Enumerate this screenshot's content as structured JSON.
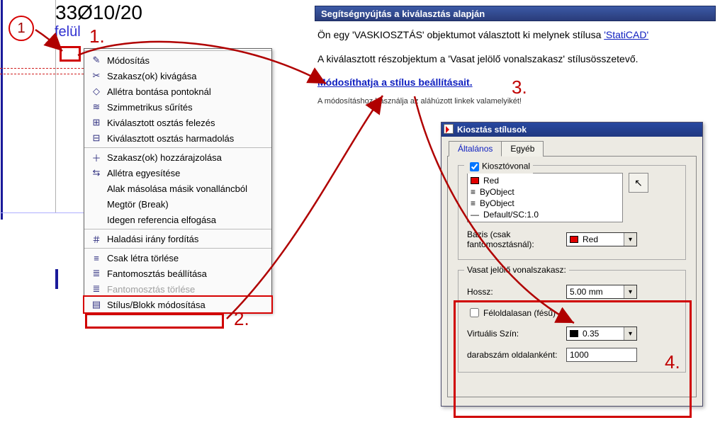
{
  "steps": {
    "s1": "1",
    "s2": "2.",
    "s3": "3.",
    "s4": "4.",
    "s1dot": "1."
  },
  "drawing": {
    "rebar": "33Ø10/20",
    "felul": "felül"
  },
  "menu": {
    "items": [
      {
        "icon": "✎",
        "label": "Módosítás"
      },
      {
        "icon": "✂",
        "label": "Szakasz(ok) kivágása"
      },
      {
        "icon": "◇",
        "label": "Allétra bontása pontoknál"
      },
      {
        "icon": "≋",
        "label": "Szimmetrikus sűrítés"
      },
      {
        "icon": "⊞",
        "label": "Kiválasztott osztás felezés"
      },
      {
        "icon": "⊟",
        "label": "Kiválasztott osztás harmadolás"
      },
      {
        "icon": "＋",
        "label": "Szakasz(ok) hozzárajzolása"
      },
      {
        "icon": "⇆",
        "label": "Allétra egyesítése"
      },
      {
        "icon": "",
        "label": "Alak másolása másik vonalláncból"
      },
      {
        "icon": "",
        "label": "Megtör (Break)"
      },
      {
        "icon": "",
        "label": "Idegen referencia elfogása"
      },
      {
        "icon": "＃",
        "label": "Haladási irány fordítás"
      },
      {
        "icon": "≡",
        "label": "Csak létra törlése"
      },
      {
        "icon": "≣",
        "label": "Fantomosztás beállítása"
      },
      {
        "icon": "≣",
        "label": "Fantomosztás törlése",
        "disabled": true
      },
      {
        "icon": "▤",
        "label": "Stílus/Blokk módosítása",
        "highlighted": true
      }
    ]
  },
  "help": {
    "header": "Segítségnyújtás a kiválasztás alapján",
    "line1a": "Ön egy 'VASKIOSZTÁS' objektumot választott ki melynek stílusa ",
    "line1link": "'StatiCAD'",
    "line2": "A kiválasztott részobjektum a 'Vasat jelölő vonalszakasz' stílusösszetevő.",
    "line3": "Módosíthatja a stílus beállításait.",
    "note": "A módosításhoz használja az aláhúzott linkek valamelyikét!"
  },
  "dialog": {
    "title": "Kiosztás stílusok",
    "tab_general": "Általános",
    "tab_other": "Egyéb",
    "grp_line": "Kiosztóvonal",
    "list": {
      "r1": "Red",
      "r2": "ByObject",
      "r3": "ByObject",
      "r4": "Default/SC:1.0"
    },
    "basis_lbl": "Bázis (csak fantomosztásnál):",
    "basis_val": "Red",
    "grp_marker": "Vasat jelölő vonalszakasz:",
    "len_lbl": "Hossz:",
    "len_val": "5.00 mm",
    "half_lbl": "Féloldalasan (fésű)",
    "vcolor_lbl": "Virtuális Szín:",
    "vcolor_val": "0.35",
    "count_lbl": "darabszám oldalanként:",
    "count_val": "1000"
  }
}
